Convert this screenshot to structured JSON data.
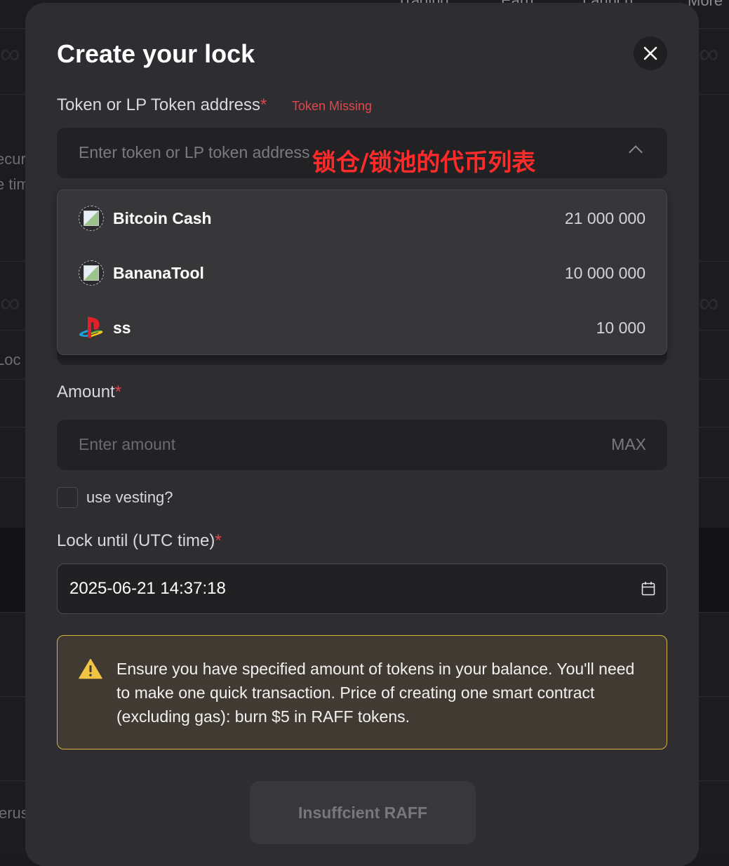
{
  "background": {
    "nav_items": [
      "Trading",
      "Earn",
      "Launch",
      "More"
    ],
    "left_fragments": [
      "ecur",
      "e tim",
      "Loc",
      "erus"
    ]
  },
  "modal": {
    "title": "Create your lock",
    "close_icon": "close-icon",
    "token_field": {
      "label": "Token or LP Token address",
      "required_mark": "*",
      "error": "Token Missing",
      "placeholder": "Enter token or LP token address",
      "chevron_icon": "chevron-up-icon"
    },
    "annotation": "锁仓/锁池的代币列表",
    "token_list": [
      {
        "name": "Bitcoin Cash",
        "balance": "21 000 000",
        "icon": "broken-image-icon"
      },
      {
        "name": "BananaTool",
        "balance": "10 000 000",
        "icon": "broken-image-icon"
      },
      {
        "name": "ss",
        "balance": "10 000",
        "icon": "playstation-logo-icon"
      }
    ],
    "amount_field": {
      "label": "Amount",
      "required_mark": "*",
      "placeholder": "Enter amount",
      "max_label": "MAX"
    },
    "vesting": {
      "label": "use vesting?",
      "checked": false
    },
    "lock_until": {
      "label": "Lock until (UTC time)",
      "required_mark": "*",
      "value": "2025-06-21 14:37:18",
      "calendar_icon": "calendar-icon"
    },
    "warning": {
      "icon": "warning-icon",
      "text": "Ensure you have specified amount of tokens in your balance. You'll need to make one quick transaction. Price of creating one smart contract (excluding gas): burn $5 in RAFF tokens."
    },
    "submit_label": "Insuffcient RAFF"
  },
  "colors": {
    "modal_bg": "#2e2e32",
    "input_bg": "#222225",
    "error_red": "#e0474c",
    "warning_border": "#d8b23b",
    "warning_bg": "#413a33"
  }
}
